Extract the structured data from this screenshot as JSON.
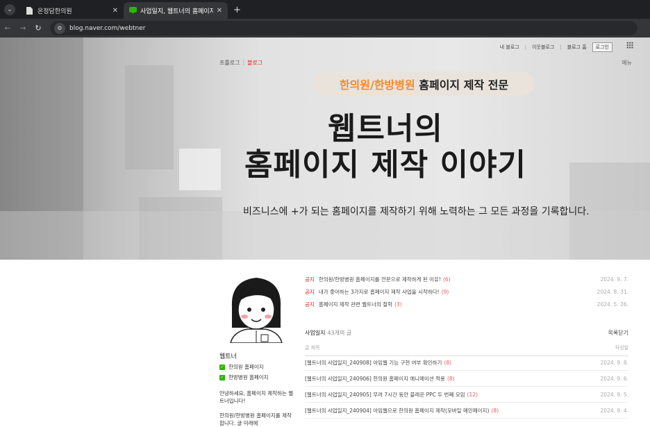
{
  "browser": {
    "tabs": [
      {
        "title": "온정담한의원",
        "active": false
      },
      {
        "title": "사업일지, 웹트너의 홈페이지 제",
        "active": true
      }
    ],
    "url": "blog.naver.com/webtner"
  },
  "header": {
    "top_links": [
      "내 블로그",
      "이웃블로그",
      "블로그 홈",
      "로그인"
    ],
    "blog_tabs": [
      "프롤로그",
      "블로그"
    ],
    "menu_label": "메뉴"
  },
  "hero": {
    "pill_highlight": "한의원/한방병원",
    "pill_rest": " 홈페이지 제작 전문",
    "headline_line1": "웹트너의",
    "headline_line2": "홈페이지 제작 이야기",
    "subline": "비즈니스에 +가 되는 홈페이지를 제작하기 위해 노력하는 그 모든 과정을 기록합니다."
  },
  "profile": {
    "name": "웹트너",
    "categories": [
      "한의원 홈페이지",
      "한방병원 홈페이지"
    ],
    "desc1": "안녕하세요, 홈페이지 제작하는 웹트너입니다!",
    "desc2": "한의원/한방병원 홈페이지를 제작합니다. 글 미래에"
  },
  "notices": [
    {
      "tag": "공지",
      "title": "한의원/한방병원 홈페이지를 전문으로 제작하게 된 이유!",
      "count": "(6)",
      "date": "2024. 9. 7."
    },
    {
      "tag": "공지",
      "title": "내가 좋아하는 3가지로 홈페이지 제작 사업을 시작하다!",
      "count": "(9)",
      "date": "2024. 8. 31."
    },
    {
      "tag": "공지",
      "title": "홈페이지 제작 관련 웹트너의 철학",
      "count": "(3)",
      "date": "2024. 5. 26."
    }
  ],
  "list": {
    "label": "사업일지",
    "count": "43개의 글",
    "toggle": "목록닫기",
    "col_title": "글 제목",
    "col_date": "작성일",
    "posts": [
      {
        "title": "[웹트너의 사업일지_240908] 아임웹 기능 구현 여부 확인하기",
        "count": "(8)",
        "date": "2024. 9. 8."
      },
      {
        "title": "[웹트너의 사업일지_240906] 한의원 홈페이지 애니메이션 적용",
        "count": "(8)",
        "date": "2024. 9. 6."
      },
      {
        "title": "[웹트너의 사업일지_240905] 무려 7시간 동안 블레운 PPC 두 번째 모임",
        "count": "(12)",
        "date": "2024. 9. 5."
      },
      {
        "title": "[웹트너의 사업일지_240904] 아임웹으로 한의원 홈페이지 제작(모바일 메인페이지)",
        "count": "(8)",
        "date": "2024. 9. 4."
      }
    ]
  },
  "colors": {
    "accent_orange": "#f28a2e",
    "naver_green": "#2db400",
    "notice_red": "#e02020"
  }
}
